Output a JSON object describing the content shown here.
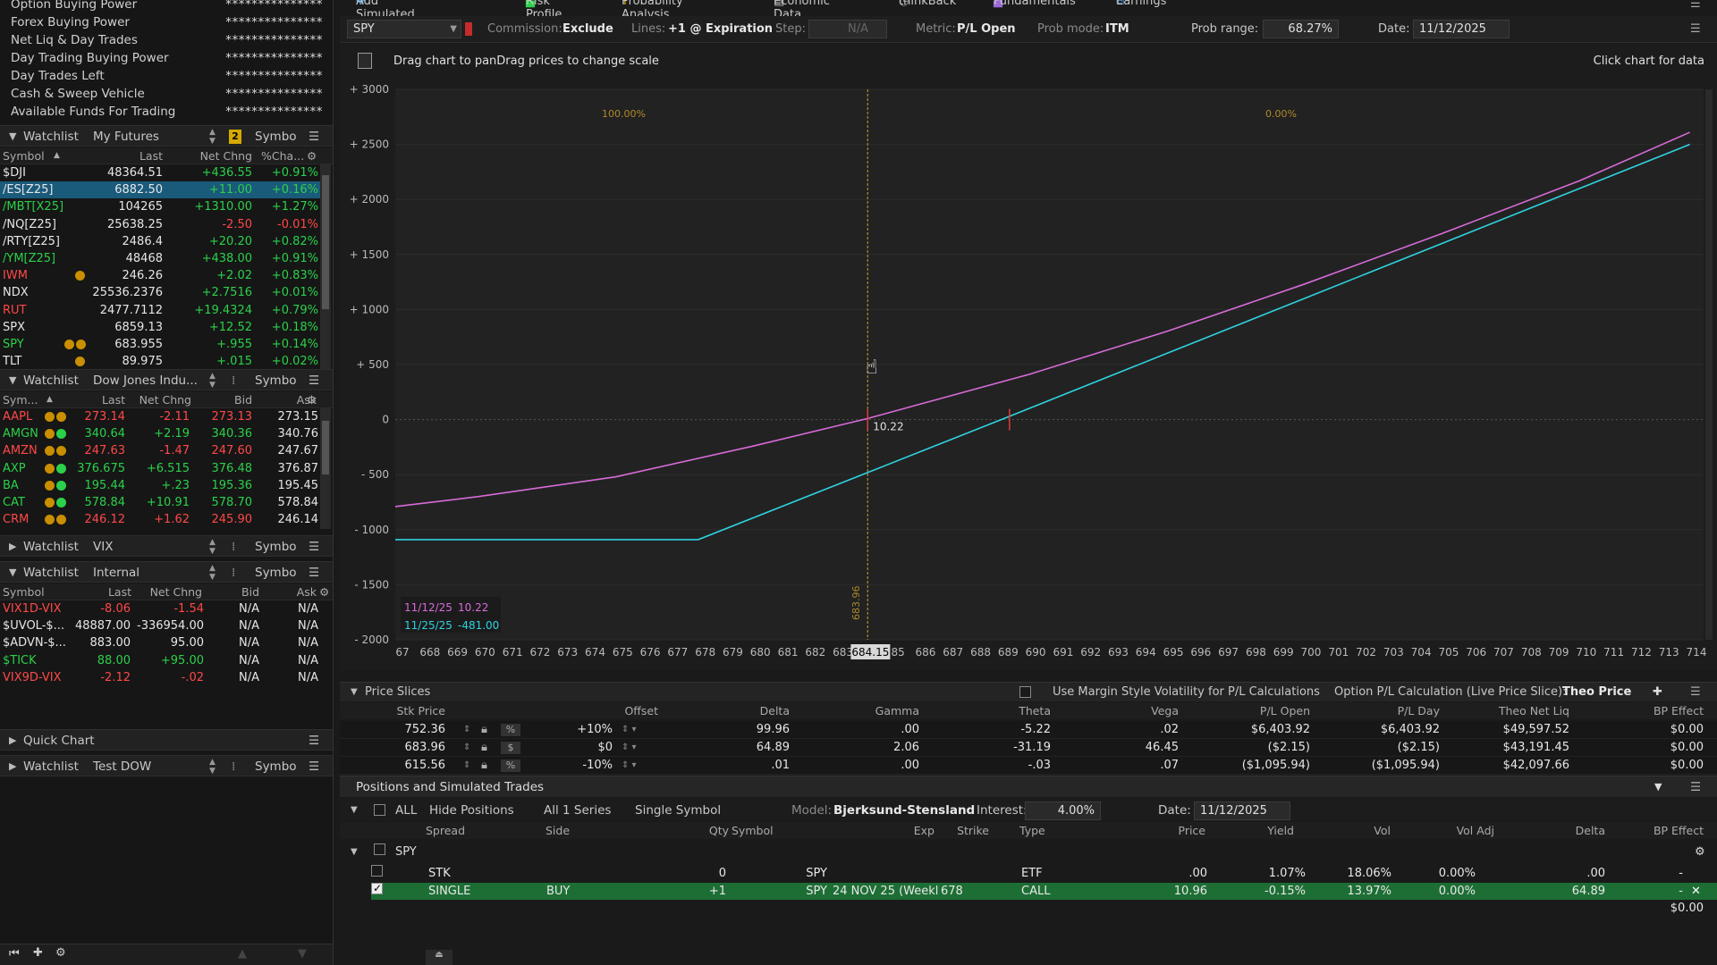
{
  "account": [
    {
      "label": "Option Buying Power",
      "value": "***************"
    },
    {
      "label": "Forex Buying Power",
      "value": "***************"
    },
    {
      "label": "Net Liq & Day Trades",
      "value": "***************"
    },
    {
      "label": "Day Trading Buying Power",
      "value": "***************"
    },
    {
      "label": "Day Trades Left",
      "value": "***************"
    },
    {
      "label": "Cash & Sweep Vehicle",
      "value": "***************"
    },
    {
      "label": "Available Funds For Trading",
      "value": "***************"
    }
  ],
  "watchlist_label": "Watchlist",
  "symbol_btn": "Symbo",
  "wl1": {
    "name": "My Futures",
    "badge": "2",
    "cols": [
      "Symbol",
      "Last",
      "Net Chng",
      "%Cha..."
    ],
    "rows": [
      {
        "sym": "$DJI",
        "last": "48364.51",
        "chg": "+436.55",
        "pct": "+0.91%",
        "c": "white"
      },
      {
        "sym": "/ES[Z25]",
        "last": "6882.50",
        "chg": "+11.00",
        "pct": "+0.16%",
        "c": "white",
        "hl": true
      },
      {
        "sym": "/MBT[X25]",
        "last": "104265",
        "chg": "+1310.00",
        "pct": "+1.27%",
        "c": "green"
      },
      {
        "sym": "/NQ[Z25]",
        "last": "25638.25",
        "chg": "-2.50",
        "pct": "-0.01%",
        "c": "white"
      },
      {
        "sym": "/RTY[Z25]",
        "last": "2486.4",
        "chg": "+20.20",
        "pct": "+0.82%",
        "c": "white"
      },
      {
        "sym": "/YM[Z25]",
        "last": "48468",
        "chg": "+438.00",
        "pct": "+0.91%",
        "c": "green"
      },
      {
        "sym": "IWM",
        "last": "246.26",
        "chg": "+2.02",
        "pct": "+0.83%",
        "c": "red"
      },
      {
        "sym": "NDX",
        "last": "25536.2376",
        "chg": "+2.7516",
        "pct": "+0.01%",
        "c": "white"
      },
      {
        "sym": "RUT",
        "last": "2477.7112",
        "chg": "+19.4324",
        "pct": "+0.79%",
        "c": "red"
      },
      {
        "sym": "SPX",
        "last": "6859.13",
        "chg": "+12.52",
        "pct": "+0.18%",
        "c": "white"
      },
      {
        "sym": "SPY",
        "last": "683.955",
        "chg": "+.955",
        "pct": "+0.14%",
        "c": "green"
      },
      {
        "sym": "TLT",
        "last": "89.975",
        "chg": "+.015",
        "pct": "+0.02%",
        "c": "white"
      }
    ]
  },
  "wl2": {
    "name": "Dow Jones Indu...",
    "cols": [
      "Sym...",
      "Last",
      "Net Chng",
      "Bid",
      "Ask"
    ],
    "rows": [
      {
        "sym": "AAPL",
        "last": "273.14",
        "chg": "-2.11",
        "bid": "273.13",
        "ask": "273.15",
        "c": "red"
      },
      {
        "sym": "AMGN",
        "last": "340.64",
        "chg": "+2.19",
        "bid": "340.36",
        "ask": "340.76",
        "c": "green"
      },
      {
        "sym": "AMZN",
        "last": "247.63",
        "chg": "-1.47",
        "bid": "247.60",
        "ask": "247.67",
        "c": "red"
      },
      {
        "sym": "AXP",
        "last": "376.675",
        "chg": "+6.515",
        "bid": "376.48",
        "ask": "376.87",
        "c": "green"
      },
      {
        "sym": "BA",
        "last": "195.44",
        "chg": "+.23",
        "bid": "195.36",
        "ask": "195.45",
        "c": "green"
      },
      {
        "sym": "CAT",
        "last": "578.84",
        "chg": "+10.91",
        "bid": "578.70",
        "ask": "578.84",
        "c": "green"
      },
      {
        "sym": "CRM",
        "last": "246.12",
        "chg": "+1.62",
        "bid": "245.90",
        "ask": "246.14",
        "c": "red"
      }
    ]
  },
  "wl3": {
    "name": "VIX"
  },
  "wl4": {
    "name": "Internal",
    "cols": [
      "Symbol",
      "Last",
      "Net Chng",
      "Bid",
      "Ask"
    ],
    "rows": [
      {
        "sym": "VIX1D-VIX",
        "last": "-8.06",
        "chg": "-1.54",
        "bid": "N/A",
        "ask": "N/A",
        "c": "red"
      },
      {
        "sym": "$UVOL-$...",
        "last": "48887.00",
        "chg": "-336954.00",
        "bid": "N/A",
        "ask": "N/A",
        "c": "white"
      },
      {
        "sym": "$ADVN-$...",
        "last": "883.00",
        "chg": "95.00",
        "bid": "N/A",
        "ask": "N/A",
        "c": "white"
      },
      {
        "sym": "$TICK",
        "last": "88.00",
        "chg": "+95.00",
        "bid": "N/A",
        "ask": "N/A",
        "c": "green"
      },
      {
        "sym": "VIX9D-VIX",
        "last": "-2.12",
        "chg": "-.02",
        "bid": "N/A",
        "ask": "N/A",
        "c": "red"
      }
    ]
  },
  "quick_chart": "Quick Chart",
  "wl5": {
    "name": "Test DOW"
  },
  "topnav": [
    "Add Simulated Trades",
    "Risk Profile",
    "Probability Analysis",
    "Economic Data",
    "thinkBack",
    "Fundamentals",
    "Earnings"
  ],
  "toolbar": {
    "symbol": "SPY",
    "commission_label": "Commission:",
    "commission": "Exclude",
    "lines_label": "Lines:",
    "lines": "+1 @ Expiration",
    "step_label": "Step:",
    "step": "N/A",
    "metric_label": "Metric:",
    "metric": "P/L Open",
    "prob_mode_label": "Prob mode:",
    "prob_mode": "ITM",
    "prob_range_label": "Prob range:",
    "prob_range": "68.27%",
    "date_label": "Date:",
    "date": "11/12/2025"
  },
  "chart_hint": "Drag chart to panDrag prices to change scale",
  "chart_click": "Click chart for data",
  "chart_data": {
    "type": "line",
    "ylim": [
      -2000,
      3000
    ],
    "xlim": [
      667,
      714.5
    ],
    "yticks": [
      "+ 3000",
      "+ 2500",
      "+ 2000",
      "+ 1500",
      "+ 1000",
      "+ 500",
      "0",
      "- 500",
      "- 1000",
      "- 1500",
      "- 2000"
    ],
    "xticks": [
      "67",
      "668",
      "669",
      "670",
      "671",
      "672",
      "673",
      "674",
      "675",
      "676",
      "677",
      "678",
      "679",
      "680",
      "681",
      "682",
      "683",
      "684.15",
      "85",
      "686",
      "687",
      "688",
      "689",
      "690",
      "691",
      "692",
      "693",
      "694",
      "695",
      "696",
      "697",
      "698",
      "699",
      "700",
      "701",
      "702",
      "703",
      "704",
      "705",
      "706",
      "707",
      "708",
      "709",
      "710",
      "711",
      "712",
      "713",
      "714"
    ],
    "current_price": 684.15,
    "current_price_label": "683.96",
    "prob_left": "100.00%",
    "prob_right": "0.00%",
    "cursor_label": "10.22",
    "legend": [
      {
        "date": "11/12/25",
        "value": "10.22",
        "color": "#d86bd8"
      },
      {
        "date": "11/25/25",
        "value": "-481.00",
        "color": "#2ed3e0"
      }
    ],
    "series": [
      {
        "color": "#d86bd8",
        "x": [
          667,
          670,
          675,
          680,
          684.15,
          690,
          695,
          700,
          705,
          710,
          714
        ],
        "y": [
          -790,
          -700,
          -520,
          -240,
          10,
          410,
          800,
          1230,
          1690,
          2170,
          2610
        ]
      },
      {
        "color": "#2ed3e0",
        "x": [
          667,
          675,
          678,
          684.15,
          689,
          695,
          700,
          705,
          710,
          714
        ],
        "y": [
          -1090,
          -1090,
          -1090,
          -481,
          0,
          600,
          1100,
          1600,
          2100,
          2500
        ]
      }
    ]
  },
  "price_slices": {
    "title": "Price Slices",
    "margin_vol": "Use Margin Style Volatility for P/L Calculations",
    "calc_label": "Option P/L Calculation (Live Price Slice):",
    "calc_value": "Theo Price",
    "cols": [
      "Stk Price",
      "Offset",
      "Delta",
      "Gamma",
      "Theta",
      "Vega",
      "P/L Open",
      "P/L Day",
      "Theo Net Liq",
      "BP Effect"
    ],
    "rows": [
      {
        "stk": "752.36",
        "unit": "%",
        "offset": "+10%",
        "delta": "99.96",
        "gamma": ".00",
        "theta": "-5.22",
        "vega": ".02",
        "plopen": "$6,403.92",
        "plday": "$6,403.92",
        "theo": "$49,597.52",
        "bp": "$0.00"
      },
      {
        "stk": "683.96",
        "unit": "$",
        "offset": "$0",
        "delta": "64.89",
        "gamma": "2.06",
        "theta": "-31.19",
        "vega": "46.45",
        "plopen": "($2.15)",
        "plday": "($2.15)",
        "theo": "$43,191.45",
        "bp": "$0.00"
      },
      {
        "stk": "615.56",
        "unit": "%",
        "offset": "-10%",
        "delta": ".01",
        "gamma": ".00",
        "theta": "-.03",
        "vega": ".07",
        "plopen": "($1,095.94)",
        "plday": "($1,095.94)",
        "theo": "$42,097.66",
        "bp": "$0.00"
      }
    ]
  },
  "positions": {
    "title": "Positions and Simulated Trades",
    "all": "ALL",
    "hide": "Hide Positions",
    "series": "All 1 Series",
    "single": "Single Symbol",
    "model_label": "Model:",
    "model": "Bjerksund-Stensland",
    "interest_label": "Interest:",
    "interest": "4.00%",
    "date_label": "Date:",
    "date": "11/12/2025",
    "cols": [
      "Spread",
      "Side",
      "Qty",
      "Symbol",
      "Exp",
      "Strike",
      "Type",
      "Price",
      "Yield",
      "Vol",
      "Vol Adj",
      "Delta",
      "BP Effect"
    ],
    "group": "SPY",
    "rows": [
      {
        "spread": "STK",
        "side": "",
        "qty": "0",
        "symbol": "SPY",
        "exp": "",
        "strike": "",
        "type": "ETF",
        "price": ".00",
        "yield": "1.07%",
        "vol": "18.06%",
        "voladj": "0.00%",
        "delta": ".00",
        "bp": "-"
      },
      {
        "spread": "SINGLE",
        "side": "BUY",
        "qty": "+1",
        "symbol": "SPY",
        "exp": "24 NOV 25 (Weekl",
        "strike": "678",
        "type": "CALL",
        "price": "10.96",
        "yield": "-0.15%",
        "vol": "13.97%",
        "voladj": "0.00%",
        "delta": "64.89",
        "bp": "-"
      }
    ],
    "total_bp": "$0.00"
  }
}
